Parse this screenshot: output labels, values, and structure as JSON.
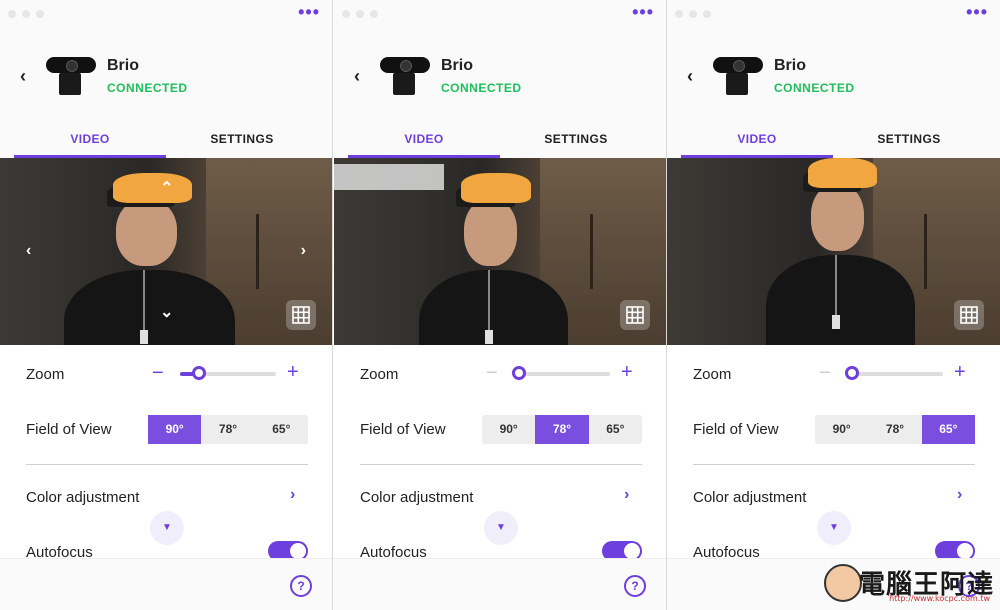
{
  "colors": {
    "accent": "#6d3fdc",
    "connected": "#1fbf5c",
    "fov_selected": "#7a4fe0"
  },
  "panels": [
    {
      "device": {
        "name": "Brio",
        "status": "CONNECTED"
      },
      "tabs": [
        {
          "label": "VIDEO",
          "active": true
        },
        {
          "label": "SETTINGS",
          "active": false
        }
      ],
      "zoom": {
        "label": "Zoom",
        "minus": "−",
        "plus": "+",
        "level": 0.15,
        "minus_enabled": true
      },
      "fov": {
        "label": "Field of View",
        "options": [
          "90°",
          "78°",
          "65°"
        ],
        "selected": 0
      },
      "color_adjustment": {
        "label": "Color adjustment"
      },
      "autofocus": {
        "label": "Autofocus",
        "on": true
      },
      "help": "?"
    },
    {
      "device": {
        "name": "Brio",
        "status": "CONNECTED"
      },
      "tabs": [
        {
          "label": "VIDEO",
          "active": true
        },
        {
          "label": "SETTINGS",
          "active": false
        }
      ],
      "zoom": {
        "label": "Zoom",
        "minus": "−",
        "plus": "+",
        "level": 0.0,
        "minus_enabled": false
      },
      "fov": {
        "label": "Field of View",
        "options": [
          "90°",
          "78°",
          "65°"
        ],
        "selected": 1
      },
      "color_adjustment": {
        "label": "Color adjustment"
      },
      "autofocus": {
        "label": "Autofocus",
        "on": true
      },
      "help": "?"
    },
    {
      "device": {
        "name": "Brio",
        "status": "CONNECTED"
      },
      "tabs": [
        {
          "label": "VIDEO",
          "active": true
        },
        {
          "label": "SETTINGS",
          "active": false
        }
      ],
      "zoom": {
        "label": "Zoom",
        "minus": "−",
        "plus": "+",
        "level": 0.0,
        "minus_enabled": false
      },
      "fov": {
        "label": "Field of View",
        "options": [
          "90°",
          "78°",
          "65°"
        ],
        "selected": 2
      },
      "color_adjustment": {
        "label": "Color adjustment"
      },
      "autofocus": {
        "label": "Autofocus",
        "on": true
      },
      "help": "?"
    }
  ],
  "watermark": {
    "text": "電腦王阿達",
    "url": "http://www.kocpc.com.tw"
  }
}
